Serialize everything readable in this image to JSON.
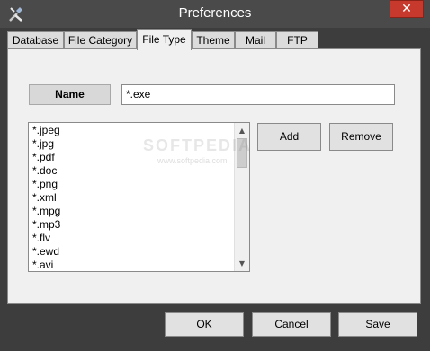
{
  "window": {
    "title": "Preferences",
    "close_glyph": "✕"
  },
  "tabs": [
    {
      "label": "Database"
    },
    {
      "label": "File Category"
    },
    {
      "label": "File Type"
    },
    {
      "label": "Theme"
    },
    {
      "label": "Mail"
    },
    {
      "label": "FTP"
    }
  ],
  "active_tab": "File Type",
  "form": {
    "name_label": "Name",
    "name_value": "*.exe"
  },
  "extensions": [
    "*.jpeg",
    "*.jpg",
    "*.pdf",
    "*.doc",
    "*.png",
    "*.xml",
    "*.mpg",
    "*.mp3",
    "*.flv",
    "*.ewd",
    "*.avi"
  ],
  "buttons": {
    "add": "Add",
    "remove": "Remove",
    "ok": "OK",
    "cancel": "Cancel",
    "save": "Save"
  },
  "watermark": {
    "text": "SOFTPEDIA",
    "url": "www.softpedia.com"
  },
  "colors": {
    "title_bar": "#4a4a4a",
    "close": "#c7392c",
    "panel": "#f0f0f0"
  }
}
